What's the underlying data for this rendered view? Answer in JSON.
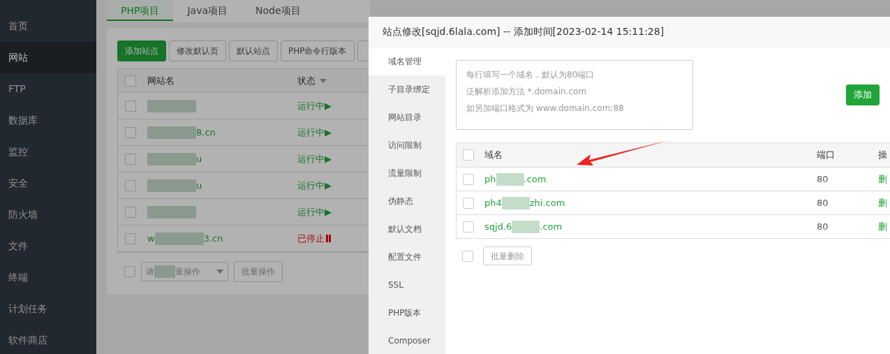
{
  "sidebar": {
    "items": [
      {
        "label": "首页",
        "selected": false
      },
      {
        "label": "网站",
        "selected": true
      },
      {
        "label": "FTP",
        "selected": false
      },
      {
        "label": "数据库",
        "selected": false
      },
      {
        "label": "监控",
        "selected": false
      },
      {
        "label": "安全",
        "selected": false
      },
      {
        "label": "防火墙",
        "selected": false
      },
      {
        "label": "文件",
        "selected": false
      },
      {
        "label": "终端",
        "selected": false
      },
      {
        "label": "计划任务",
        "selected": false
      },
      {
        "label": "软件商店",
        "selected": false
      }
    ]
  },
  "tabs": [
    {
      "label": "PHP项目",
      "selected": true
    },
    {
      "label": "Java项目",
      "selected": false
    },
    {
      "label": "Node项目",
      "selected": false
    }
  ],
  "toolbar": [
    {
      "label": "添加站点",
      "kind": "primary"
    },
    {
      "label": "修改默认页",
      "kind": "default"
    },
    {
      "label": "默认站点",
      "kind": "default"
    },
    {
      "label": "PHP命令行版本",
      "kind": "default"
    }
  ],
  "sites_table": {
    "columns": [
      "网站名",
      "状态"
    ],
    "all_checked": false,
    "rows": [
      {
        "name_parts": [],
        "status": "运行中▶",
        "running": true,
        "checked": false
      },
      {
        "name_parts": [
          "8.cn"
        ],
        "status": "运行中▶",
        "running": true,
        "checked": false
      },
      {
        "name_parts": [
          "u"
        ],
        "status": "运行中▶",
        "running": true,
        "checked": false
      },
      {
        "name_parts": [
          "u"
        ],
        "status": "运行中▶",
        "running": true,
        "checked": false
      },
      {
        "name_parts": [],
        "status": "运行中▶",
        "running": true,
        "checked": false
      },
      {
        "name_parts": [
          "w",
          "3.cn"
        ],
        "status": "已停止",
        "running": false,
        "checked": false
      }
    ]
  },
  "batch": {
    "checked": false,
    "select_parts": [
      "请",
      "量操作"
    ],
    "button": "批量操作"
  },
  "modal": {
    "title": "站点修改[sqjd.6lala.com] -- 添加时间[2023-02-14 15:11:28]",
    "nav": [
      {
        "label": "域名管理",
        "selected": true
      },
      {
        "label": "子目录绑定",
        "selected": false
      },
      {
        "label": "网站目录",
        "selected": false
      },
      {
        "label": "访问限制",
        "selected": false
      },
      {
        "label": "流量限制",
        "selected": false
      },
      {
        "label": "伪静态",
        "selected": false
      },
      {
        "label": "默认文档",
        "selected": false
      },
      {
        "label": "配置文件",
        "selected": false
      },
      {
        "label": "SSL",
        "selected": false
      },
      {
        "label": "PHP版本",
        "selected": false
      },
      {
        "label": "Composer",
        "selected": false
      }
    ],
    "domain_input": {
      "placeholder_lines": [
        "每行填写一个域名，默认为80端口",
        "泛解析添加方法 *.domain.com",
        "如另加端口格式为 www.domain.com:88"
      ]
    },
    "add_button": "添加",
    "table": {
      "columns": [
        "域名",
        "端口",
        "操"
      ],
      "all_checked": false,
      "rows": [
        {
          "domain_parts": [
            "ph",
            ".com"
          ],
          "port": "80",
          "action": "删",
          "checked": false
        },
        {
          "domain_parts": [
            "ph4",
            "zhi.com"
          ],
          "port": "80",
          "action": "删",
          "checked": false
        },
        {
          "domain_parts": [
            "sqjd.6",
            ".com"
          ],
          "port": "80",
          "action": "删",
          "checked": false
        }
      ]
    },
    "batch_checked": false,
    "batch_delete": "批量删除"
  }
}
